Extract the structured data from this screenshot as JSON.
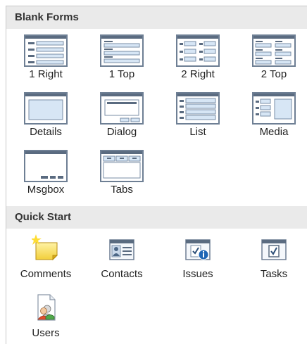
{
  "sections": {
    "blank_forms": {
      "title": "Blank Forms",
      "items": [
        {
          "label": "1 Right",
          "icon": "form-1-right-icon"
        },
        {
          "label": "1 Top",
          "icon": "form-1-top-icon"
        },
        {
          "label": "2 Right",
          "icon": "form-2-right-icon"
        },
        {
          "label": "2 Top",
          "icon": "form-2-top-icon"
        },
        {
          "label": "Details",
          "icon": "form-details-icon"
        },
        {
          "label": "Dialog",
          "icon": "form-dialog-icon"
        },
        {
          "label": "List",
          "icon": "form-list-icon"
        },
        {
          "label": "Media",
          "icon": "form-media-icon"
        },
        {
          "label": "Msgbox",
          "icon": "form-msgbox-icon"
        },
        {
          "label": "Tabs",
          "icon": "form-tabs-icon"
        }
      ]
    },
    "quick_start": {
      "title": "Quick Start",
      "items": [
        {
          "label": "Comments",
          "icon": "comments-icon"
        },
        {
          "label": "Contacts",
          "icon": "contacts-icon"
        },
        {
          "label": "Issues",
          "icon": "issues-icon"
        },
        {
          "label": "Tasks",
          "icon": "tasks-icon"
        },
        {
          "label": "Users",
          "icon": "users-icon"
        }
      ]
    }
  },
  "colors": {
    "header_bg": "#eaeaea",
    "icon_frame": "#6e7f94",
    "icon_bar": "#5a6b80",
    "icon_field": "#d7e6f5"
  }
}
